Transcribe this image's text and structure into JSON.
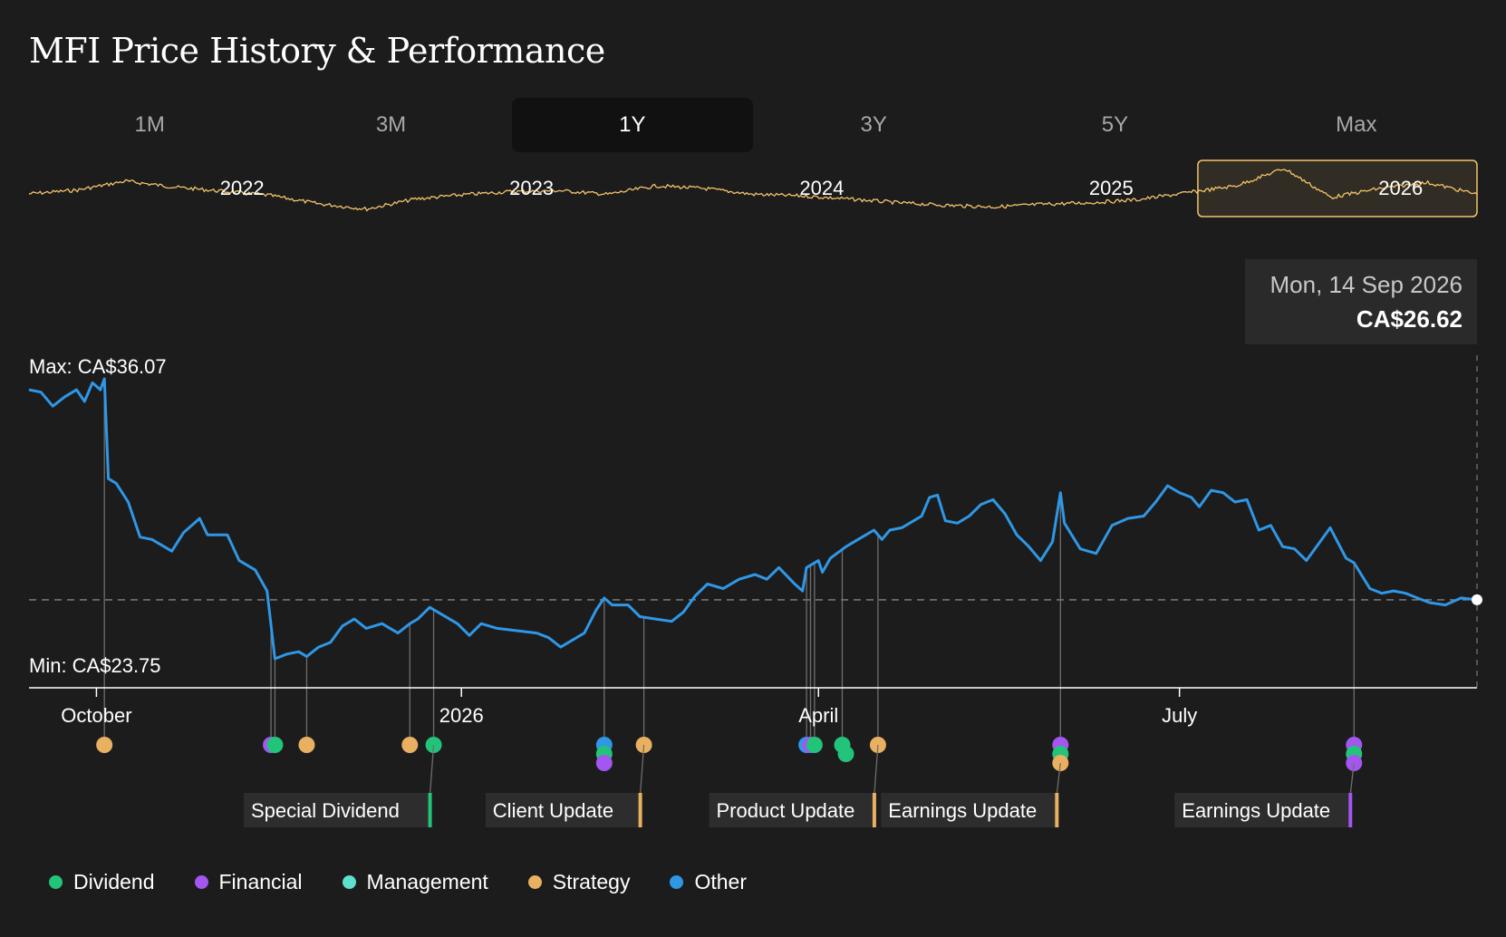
{
  "title": "MFI Price History & Performance",
  "tabs": [
    {
      "label": "1M",
      "active": false
    },
    {
      "label": "3M",
      "active": false
    },
    {
      "label": "1Y",
      "active": true
    },
    {
      "label": "3Y",
      "active": false
    },
    {
      "label": "5Y",
      "active": false
    },
    {
      "label": "Max",
      "active": false
    }
  ],
  "tooltip": {
    "date": "Mon, 14 Sep 2026",
    "price": "CA$26.62"
  },
  "colors": {
    "price_line": "#2f97e6",
    "overview_line": "#f3c46b",
    "dividend": "#22c47a",
    "financial": "#a356f0",
    "management": "#5fe0cf",
    "strategy": "#e8b060",
    "other": "#2f97e6"
  },
  "legend": [
    {
      "label": "Dividend",
      "key": "dividend"
    },
    {
      "label": "Financial",
      "key": "financial"
    },
    {
      "label": "Management",
      "key": "management"
    },
    {
      "label": "Strategy",
      "key": "strategy"
    },
    {
      "label": "Other",
      "key": "other"
    }
  ],
  "chart_data": [
    {
      "type": "line",
      "role": "range-selector",
      "year_labels": [
        "2022",
        "2023",
        "2024",
        "2025",
        "2026"
      ],
      "selected_range": "2026",
      "x": [
        "2021-09",
        "2021-11",
        "2022-01",
        "2022-03",
        "2022-05",
        "2022-07",
        "2022-09",
        "2022-11",
        "2023-01",
        "2023-03",
        "2023-05",
        "2023-07",
        "2023-09",
        "2023-11",
        "2024-01",
        "2024-03",
        "2024-05",
        "2024-07",
        "2024-09",
        "2024-11",
        "2025-01",
        "2025-03",
        "2025-05",
        "2025-07",
        "2025-09",
        "2025-11",
        "2026-01",
        "2026-03",
        "2026-05",
        "2026-07",
        "2026-09"
      ],
      "values": [
        30.5,
        31.2,
        32.9,
        31.8,
        31.0,
        30.2,
        28.6,
        27.6,
        29.5,
        30.3,
        30.9,
        31.1,
        30.4,
        32.0,
        31.5,
        30.4,
        30.1,
        29.5,
        28.8,
        28.3,
        28.0,
        28.5,
        28.8,
        29.4,
        30.7,
        32.0,
        35.3,
        29.8,
        31.5,
        32.6,
        30.4
      ]
    },
    {
      "type": "line",
      "ylabel_max": "Max: CA$36.07",
      "ylabel_min": "Min: CA$23.75",
      "y_max": 36.07,
      "y_min": 23.75,
      "current_value": 26.62,
      "x_tick_labels": [
        "October",
        "2026",
        "April",
        "July"
      ],
      "x_ticks": [
        "2025-10-01",
        "2026-01-01",
        "2026-04-01",
        "2026-07-01"
      ],
      "x_range": [
        "2025-09-14",
        "2026-09-14"
      ],
      "series": [
        {
          "points": [
            [
              "2025-09-14",
              35.6
            ],
            [
              "2025-09-17",
              35.5
            ],
            [
              "2025-09-20",
              34.9
            ],
            [
              "2025-09-23",
              35.3
            ],
            [
              "2025-09-26",
              35.6
            ],
            [
              "2025-09-28",
              35.1
            ],
            [
              "2025-09-30",
              35.9
            ],
            [
              "2025-10-02",
              35.6
            ],
            [
              "2025-10-03",
              36.07
            ],
            [
              "2025-10-04",
              31.8
            ],
            [
              "2025-10-06",
              31.6
            ],
            [
              "2025-10-09",
              30.8
            ],
            [
              "2025-10-12",
              29.3
            ],
            [
              "2025-10-15",
              29.2
            ],
            [
              "2025-10-20",
              28.7
            ],
            [
              "2025-10-23",
              29.5
            ],
            [
              "2025-10-27",
              30.1
            ],
            [
              "2025-10-29",
              29.4
            ],
            [
              "2025-11-03",
              29.4
            ],
            [
              "2025-11-06",
              28.3
            ],
            [
              "2025-11-10",
              27.9
            ],
            [
              "2025-11-13",
              27.0
            ],
            [
              "2025-11-15",
              24.1
            ],
            [
              "2025-11-18",
              24.3
            ],
            [
              "2025-11-21",
              24.4
            ],
            [
              "2025-11-23",
              24.2
            ],
            [
              "2025-11-26",
              24.6
            ],
            [
              "2025-11-29",
              24.8
            ],
            [
              "2025-12-02",
              25.5
            ],
            [
              "2025-12-05",
              25.8
            ],
            [
              "2025-12-08",
              25.4
            ],
            [
              "2025-12-12",
              25.6
            ],
            [
              "2025-12-16",
              25.2
            ],
            [
              "2025-12-19",
              25.6
            ],
            [
              "2025-12-21",
              25.8
            ],
            [
              "2025-12-24",
              26.3
            ],
            [
              "2025-12-27",
              26.0
            ],
            [
              "2025-12-31",
              25.6
            ],
            [
              "2026-01-03",
              25.1
            ],
            [
              "2026-01-06",
              25.6
            ],
            [
              "2026-01-10",
              25.4
            ],
            [
              "2026-01-15",
              25.3
            ],
            [
              "2026-01-20",
              25.2
            ],
            [
              "2026-01-23",
              25.0
            ],
            [
              "2026-01-26",
              24.6
            ],
            [
              "2026-01-29",
              24.9
            ],
            [
              "2026-02-01",
              25.2
            ],
            [
              "2026-02-04",
              26.2
            ],
            [
              "2026-02-06",
              26.7
            ],
            [
              "2026-02-08",
              26.4
            ],
            [
              "2026-02-12",
              26.4
            ],
            [
              "2026-02-15",
              25.9
            ],
            [
              "2026-02-19",
              25.8
            ],
            [
              "2026-02-23",
              25.7
            ],
            [
              "2026-02-26",
              26.1
            ],
            [
              "2026-03-01",
              26.8
            ],
            [
              "2026-03-04",
              27.3
            ],
            [
              "2026-03-08",
              27.1
            ],
            [
              "2026-03-12",
              27.5
            ],
            [
              "2026-03-16",
              27.7
            ],
            [
              "2026-03-19",
              27.5
            ],
            [
              "2026-03-22",
              28.0
            ],
            [
              "2026-03-26",
              27.3
            ],
            [
              "2026-03-28",
              27.0
            ],
            [
              "2026-03-29",
              28.0
            ],
            [
              "2026-04-01",
              28.3
            ],
            [
              "2026-04-02",
              27.8
            ],
            [
              "2026-04-04",
              28.4
            ],
            [
              "2026-04-08",
              28.9
            ],
            [
              "2026-04-12",
              29.3
            ],
            [
              "2026-04-15",
              29.6
            ],
            [
              "2026-04-17",
              29.2
            ],
            [
              "2026-04-19",
              29.6
            ],
            [
              "2026-04-22",
              29.7
            ],
            [
              "2026-04-25",
              30.0
            ],
            [
              "2026-04-27",
              30.2
            ],
            [
              "2026-04-29",
              31.0
            ],
            [
              "2026-05-01",
              31.1
            ],
            [
              "2026-05-03",
              30.0
            ],
            [
              "2026-05-06",
              29.9
            ],
            [
              "2026-05-09",
              30.2
            ],
            [
              "2026-05-12",
              30.7
            ],
            [
              "2026-05-15",
              30.9
            ],
            [
              "2026-05-18",
              30.3
            ],
            [
              "2026-05-21",
              29.4
            ],
            [
              "2026-05-24",
              28.9
            ],
            [
              "2026-05-27",
              28.3
            ],
            [
              "2026-05-30",
              29.1
            ],
            [
              "2026-06-01",
              31.2
            ],
            [
              "2026-06-02",
              29.9
            ],
            [
              "2026-06-06",
              28.8
            ],
            [
              "2026-06-10",
              28.6
            ],
            [
              "2026-06-14",
              29.8
            ],
            [
              "2026-06-18",
              30.1
            ],
            [
              "2026-06-22",
              30.2
            ],
            [
              "2026-06-25",
              30.8
            ],
            [
              "2026-06-28",
              31.5
            ],
            [
              "2026-07-01",
              31.2
            ],
            [
              "2026-07-04",
              31.0
            ],
            [
              "2026-07-06",
              30.6
            ],
            [
              "2026-07-09",
              31.3
            ],
            [
              "2026-07-12",
              31.2
            ],
            [
              "2026-07-15",
              30.8
            ],
            [
              "2026-07-18",
              30.9
            ],
            [
              "2026-07-21",
              29.6
            ],
            [
              "2026-07-24",
              29.8
            ],
            [
              "2026-07-27",
              28.9
            ],
            [
              "2026-07-30",
              28.8
            ],
            [
              "2026-08-02",
              28.3
            ],
            [
              "2026-08-05",
              29.0
            ],
            [
              "2026-08-08",
              29.7
            ],
            [
              "2026-08-12",
              28.4
            ],
            [
              "2026-08-14",
              28.2
            ],
            [
              "2026-08-18",
              27.1
            ],
            [
              "2026-08-21",
              26.9
            ],
            [
              "2026-08-24",
              27.0
            ],
            [
              "2026-08-27",
              26.9
            ],
            [
              "2026-08-30",
              26.7
            ],
            [
              "2026-09-02",
              26.5
            ],
            [
              "2026-09-06",
              26.4
            ],
            [
              "2026-09-10",
              26.7
            ],
            [
              "2026-09-14",
              26.62
            ]
          ]
        }
      ],
      "events": [
        {
          "date": "2025-10-03",
          "category": "strategy"
        },
        {
          "date": "2025-11-14",
          "category": "financial"
        },
        {
          "date": "2025-11-15",
          "category": "dividend"
        },
        {
          "date": "2025-11-23",
          "category": "strategy"
        },
        {
          "date": "2025-12-19",
          "category": "strategy"
        },
        {
          "date": "2025-12-25",
          "category": "dividend",
          "label": "Special Dividend"
        },
        {
          "date": "2026-02-06",
          "category": "other"
        },
        {
          "date": "2026-02-06",
          "category": "dividend"
        },
        {
          "date": "2026-02-06",
          "category": "financial"
        },
        {
          "date": "2026-02-16",
          "category": "strategy",
          "label": "Client Update"
        },
        {
          "date": "2026-03-29",
          "category": "other"
        },
        {
          "date": "2026-03-30",
          "category": "financial"
        },
        {
          "date": "2026-03-31",
          "category": "dividend"
        },
        {
          "date": "2026-04-07",
          "category": "dividend"
        },
        {
          "date": "2026-04-07",
          "category": "dividend"
        },
        {
          "date": "2026-04-16",
          "category": "strategy",
          "label": "Product Update"
        },
        {
          "date": "2026-06-01",
          "category": "financial"
        },
        {
          "date": "2026-06-01",
          "category": "dividend"
        },
        {
          "date": "2026-06-01",
          "category": "strategy",
          "label": "Earnings Update"
        },
        {
          "date": "2026-08-14",
          "category": "financial"
        },
        {
          "date": "2026-08-14",
          "category": "dividend"
        },
        {
          "date": "2026-08-14",
          "category": "financial",
          "label": "Earnings Update"
        }
      ]
    }
  ]
}
